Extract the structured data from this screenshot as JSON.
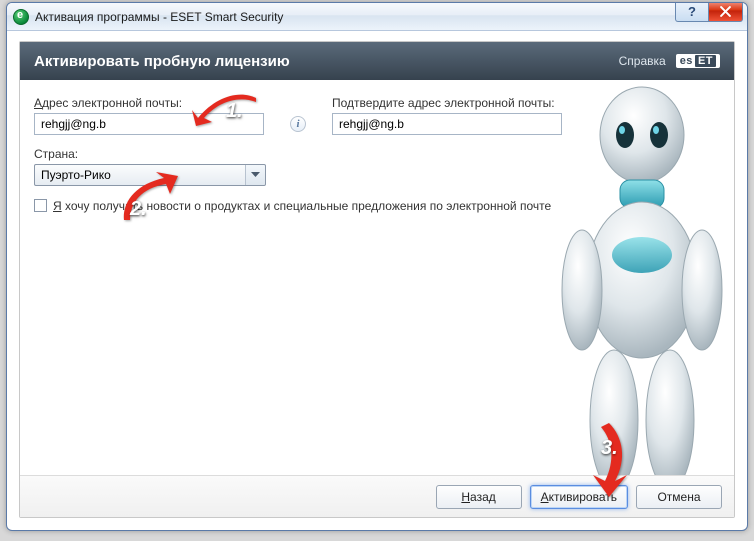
{
  "window": {
    "title": "Активация программы - ESET Smart Security",
    "help_glyph": "?",
    "close_label": "X"
  },
  "panel": {
    "title": "Активировать пробную лицензию",
    "help_link": "Справка",
    "brand_a": "es",
    "brand_b": "ET"
  },
  "form": {
    "email_label_u": "А",
    "email_label_rest": "дрес электронной почты:",
    "email_value": "rehgjj@ng.b",
    "confirm_label": "Подтвердите адрес электронной почты:",
    "confirm_value": "rehgjj@ng.b",
    "info_glyph": "i",
    "country_label": "Страна:",
    "country_value": "Пуэрто-Рико",
    "consent_u": "Я",
    "consent_rest": " хочу получать новости о продуктах и специальные предложения по электронной почте"
  },
  "footer": {
    "back_u": "Н",
    "back_rest": "азад",
    "activate_u": "А",
    "activate_rest": "ктивировать",
    "cancel_label": "Отмена"
  },
  "annotations": {
    "n1": "1.",
    "n2": "2.",
    "n3": "3."
  },
  "bg_watermark": ""
}
